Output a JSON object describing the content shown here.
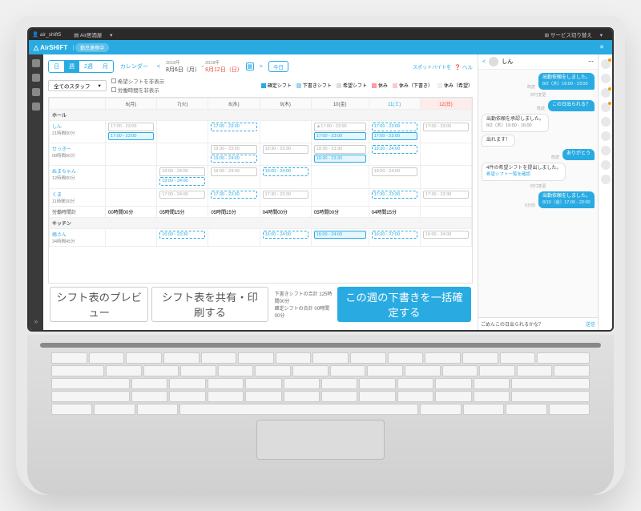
{
  "titlebar": {
    "user": "air_shift5",
    "store": "Air居酒屋",
    "switch": "サービス切り替え"
  },
  "app": {
    "name": "AirSHIFT",
    "status": "勤怠連携中"
  },
  "controls": {
    "views": [
      "日",
      "週",
      "2週",
      "月"
    ],
    "active_ix": 1,
    "calendar": "カレンダー",
    "year1": "2018年",
    "date1": "8月6日（月）",
    "dash": "-",
    "year2": "2018年",
    "date2": "8月12日（日）",
    "today": "今日",
    "spot": "スポットバイトを",
    "help": "ヘル"
  },
  "filter": {
    "staff": "全てのスタッフ",
    "check1": "希望シフトを非表示",
    "check2": "労働時間を非表示"
  },
  "legend": {
    "confirmed": "確定シフト",
    "draft": "下書きシフト",
    "request": "希望シフト",
    "rest": "休み",
    "rest_draft": "休み（下書き）",
    "rest_req": "休み（希望）",
    "c_conf": "#29abe2",
    "c_draft": "#9bd5f0",
    "c_req": "#dddddd",
    "c_rest": "#ff9aa0"
  },
  "days": [
    "6(月)",
    "7(火)",
    "8(水)",
    "9(木)",
    "10(金)",
    "11(土)",
    "12(日)"
  ],
  "groups": {
    "hall": "ホール",
    "kitchen": "キッチン"
  },
  "staff": {
    "shin": {
      "name": "しん",
      "hours": "21時間00分"
    },
    "sekki": {
      "name": "せっきー",
      "hours": "08時間00分"
    },
    "numa": {
      "name": "ぬまちゃん",
      "hours": "12時間00分"
    },
    "kuma": {
      "name": "くま",
      "hours": "11時間30分"
    },
    "worktime": {
      "name": "労働時間計"
    },
    "shima": {
      "name": "嶋さん",
      "hours": "34時間45分"
    }
  },
  "wt": [
    "00時間00分",
    "05時間15分",
    "05時間15分",
    "04時間00分",
    "05時間00分",
    "04時間15分",
    ""
  ],
  "shifts": {
    "s1": "17:00 - 23:00",
    "s2": "17:00 - 23:30",
    "s3": "19:00 - 24:00",
    "s4": "19:30 - 23:30",
    "s5": "17:30 - 23:30",
    "s6": "16:00 - 23:30",
    "s8": "16:00 - 24:00",
    "s9": "16:00 - 22:00",
    "s10": "▲17:00 - 23:00",
    "s11": "19:30 - 24:00",
    "s12": "17:00 - 24:00"
  },
  "footer": {
    "preview": "シフト表のプレビュー",
    "share": "シフト表を共有・印刷する",
    "draft_total_l": "下書きシフトの合計",
    "draft_total_v": "125時間00分",
    "conf_total_l": "確定シフトの合計",
    "conf_total_v": "00時間00分",
    "confirm": "この週の下書きを一括確定する"
  },
  "chat": {
    "name": "しん",
    "in1": "出勤依頼を承認しました。",
    "in1b": "8/2（木）16:00 - 16:00",
    "in2": "出れます！",
    "in3": "4件の希望シフトを提出しました。",
    "in3b": "希望シフト一覧を確認",
    "hdr": "日付変更",
    "out1": "出勤依頼をしました。",
    "out1b": "8/2（木）16:00 - 23:00",
    "out2": "この日出られる？",
    "out3": "ありがとう",
    "out4": "出勤依頼をしました。",
    "out4b": "8/10（金）17:00 - 23:00",
    "ts1": "既読",
    "ts2": "6分前",
    "input": "ごめんこの日出られるかな？",
    "send": "送信"
  }
}
